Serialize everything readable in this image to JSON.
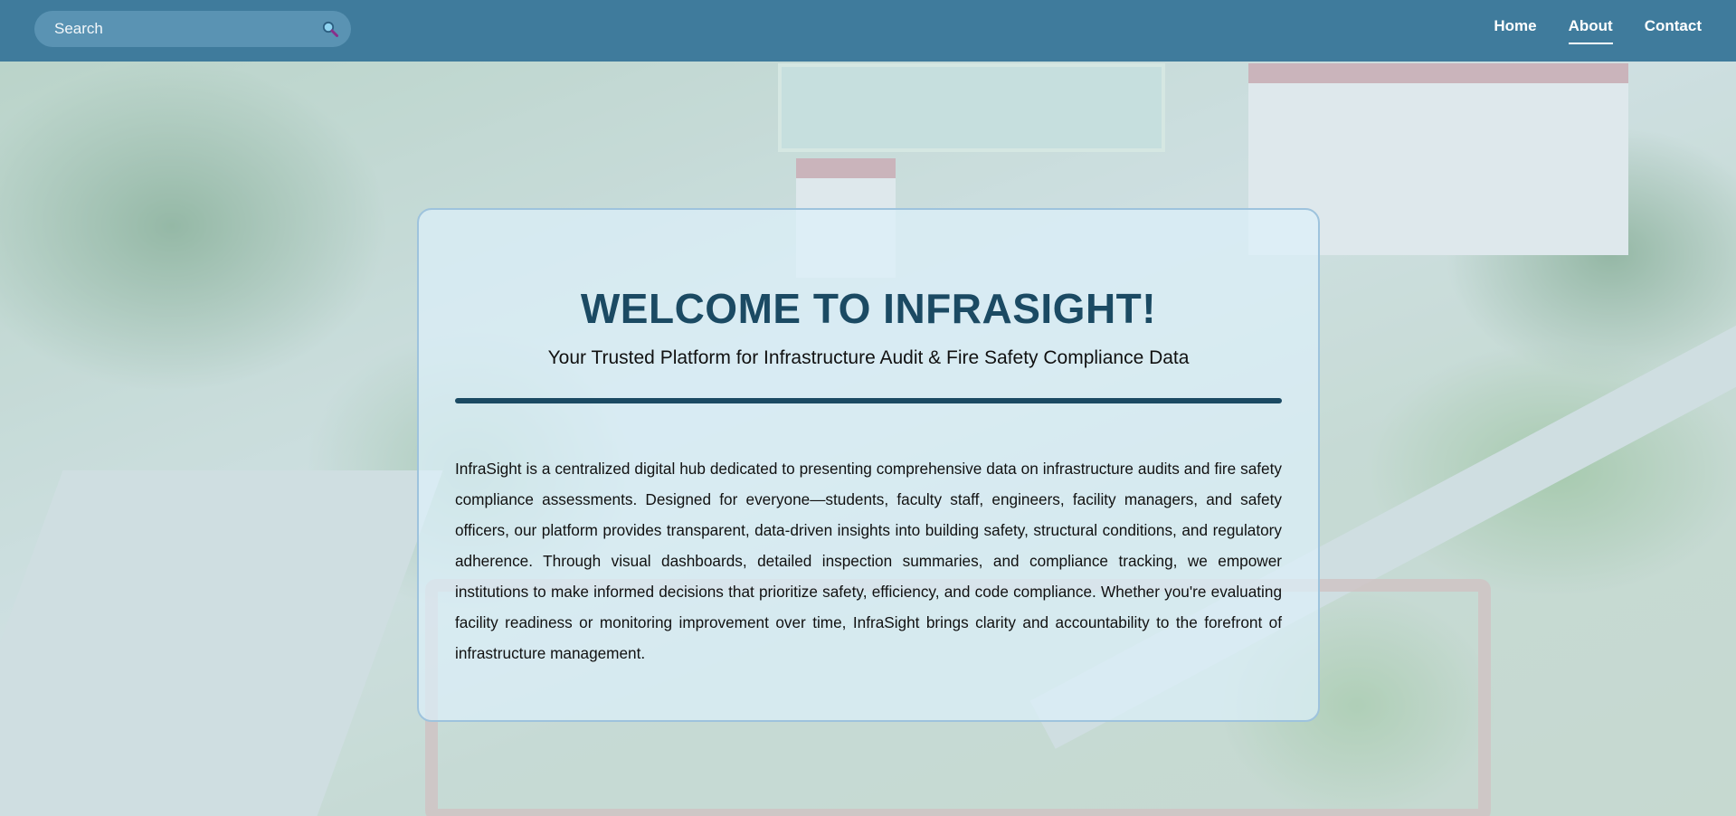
{
  "navbar": {
    "search_placeholder": "Search",
    "links": [
      {
        "label": "Home",
        "active": false
      },
      {
        "label": "About",
        "active": true
      },
      {
        "label": "Contact",
        "active": false
      }
    ]
  },
  "welcome": {
    "title": "WELCOME TO INFRASIGHT!",
    "subtitle": "Your Trusted Platform for Infrastructure Audit & Fire Safety Compliance Data",
    "body": "InfraSight is a centralized digital hub dedicated to presenting comprehensive data on infrastructure audits and fire safety compliance assessments. Designed for everyone—students, faculty staff, engineers, facility managers, and safety officers, our platform provides transparent, data-driven insights into building safety, structural conditions, and regulatory adherence. Through visual dashboards, detailed inspection summaries, and compliance tracking, we empower institutions to make informed decisions that prioritize safety, efficiency, and code compliance. Whether you're evaluating facility readiness or monitoring improvement over time, InfraSight brings clarity and accountability to the forefront of infrastructure management."
  },
  "colors": {
    "navbar_bg": "#3f7b9c",
    "search_bg": "#5a93b3",
    "title_color": "#1b4a63",
    "card_border": "#9ec3dd"
  },
  "icons": {
    "search": "magnifier-icon"
  }
}
